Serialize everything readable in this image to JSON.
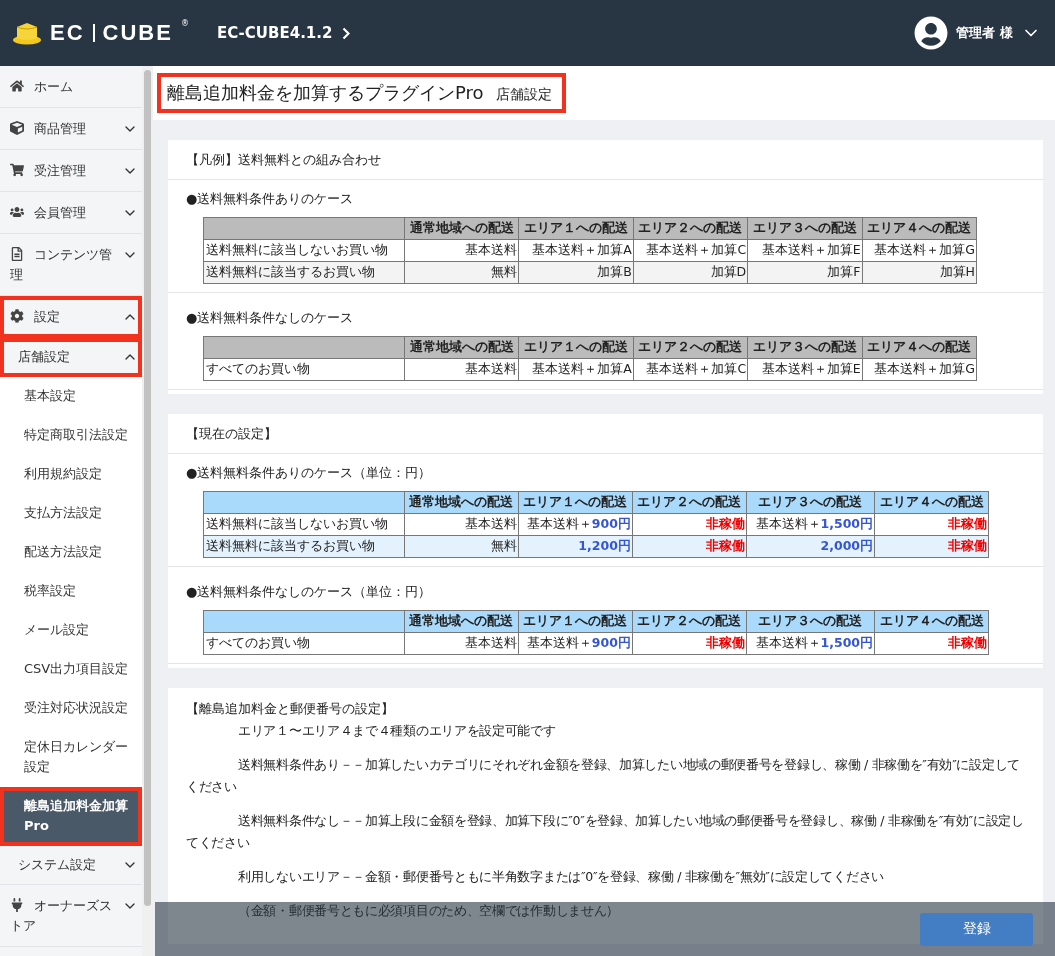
{
  "header": {
    "logo_words": [
      "EC",
      "CUBE"
    ],
    "logo_mark": "®",
    "shop": "EC-CUBE4.1.2",
    "user": "管理者 様"
  },
  "sidebar": {
    "items": [
      {
        "label": "ホーム",
        "selected": false,
        "highlighted": false
      },
      {
        "label": "商品管理",
        "expanded": false,
        "selected": false,
        "highlighted": false
      },
      {
        "label": "受注管理",
        "expanded": false,
        "selected": false,
        "highlighted": false
      },
      {
        "label": "会員管理",
        "expanded": false,
        "selected": false,
        "highlighted": false
      },
      {
        "label": "コンテンツ管理",
        "expanded": false,
        "selected": false,
        "highlighted": false
      },
      {
        "label": "設定",
        "expanded": true,
        "selected": false,
        "highlighted": true,
        "children": [
          {
            "label": "店舗設定",
            "expanded": true,
            "selected": false,
            "highlighted": true,
            "children": [
              {
                "label": "基本設定",
                "selected": false,
                "highlighted": false
              },
              {
                "label": "特定商取引法設定",
                "selected": false,
                "highlighted": false
              },
              {
                "label": "利用規約設定",
                "selected": false,
                "highlighted": false
              },
              {
                "label": "支払方法設定",
                "selected": false,
                "highlighted": false
              },
              {
                "label": "配送方法設定",
                "selected": false,
                "highlighted": false
              },
              {
                "label": "税率設定",
                "selected": false,
                "highlighted": false
              },
              {
                "label": "メール設定",
                "selected": false,
                "highlighted": false
              },
              {
                "label": "CSV出力項目設定",
                "selected": false,
                "highlighted": false
              },
              {
                "label": "受注対応状況設定",
                "selected": false,
                "highlighted": false
              },
              {
                "label": "定休日カレンダー設定",
                "selected": false,
                "highlighted": false
              },
              {
                "label": "離島追加料金加算Pro",
                "selected": true,
                "highlighted": true
              }
            ]
          },
          {
            "label": "システム設定",
            "expanded": false,
            "selected": false,
            "highlighted": false
          }
        ]
      },
      {
        "label": "オーナーズストア",
        "expanded": false,
        "selected": false,
        "highlighted": false
      }
    ]
  },
  "page": {
    "title": "離島追加料金を加算するプラグインPro",
    "subtitle": "店舗設定",
    "highlighted": true
  },
  "cards": [
    {
      "heading": "【凡例】送料無料との組み合わせ",
      "kind": "legend",
      "sections": [
        {
          "caption": "●送料無料条件ありのケース",
          "columns": [
            "通常地域への配送",
            "エリア１への配送",
            "エリア２への配送",
            "エリア３への配送",
            "エリア４への配送"
          ],
          "rows": [
            {
              "label": "送料無料に該当しないお買い物",
              "cells": [
                {
                  "text": "基本送料",
                  "kind": "plain"
                },
                {
                  "text": "基本送料＋加算A",
                  "kind": "plain"
                },
                {
                  "text": "基本送料＋加算C",
                  "kind": "plain"
                },
                {
                  "text": "基本送料＋加算E",
                  "kind": "plain"
                },
                {
                  "text": "基本送料＋加算G",
                  "kind": "plain"
                }
              ]
            },
            {
              "label": "送料無料に該当するお買い物",
              "cells": [
                {
                  "text": "無料",
                  "kind": "plain"
                },
                {
                  "text": "加算B",
                  "kind": "plain"
                },
                {
                  "text": "加算D",
                  "kind": "plain"
                },
                {
                  "text": "加算F",
                  "kind": "plain"
                },
                {
                  "text": "加算H",
                  "kind": "plain"
                }
              ]
            }
          ]
        },
        {
          "caption": "●送料無料条件なしのケース",
          "columns": [
            "通常地域への配送",
            "エリア１への配送",
            "エリア２への配送",
            "エリア３への配送",
            "エリア４への配送"
          ],
          "rows": [
            {
              "label": "すべてのお買い物",
              "cells": [
                {
                  "text": "基本送料",
                  "kind": "plain"
                },
                {
                  "text": "基本送料＋加算A",
                  "kind": "plain"
                },
                {
                  "text": "基本送料＋加算C",
                  "kind": "plain"
                },
                {
                  "text": "基本送料＋加算E",
                  "kind": "plain"
                },
                {
                  "text": "基本送料＋加算G",
                  "kind": "plain"
                }
              ]
            }
          ]
        }
      ]
    },
    {
      "heading": "【現在の設定】",
      "kind": "current",
      "sections": [
        {
          "caption": "●送料無料条件ありのケース（単位：円）",
          "columns": [
            "通常地域への配送",
            "エリア１への配送",
            "エリア２への配送",
            "エリア３への配送",
            "エリア４への配送"
          ],
          "rows": [
            {
              "label": "送料無料に該当しないお買い物",
              "cells": [
                {
                  "text": "基本送料",
                  "kind": "plain"
                },
                {
                  "text": "基本送料＋**900円**",
                  "kind": "plain"
                },
                {
                  "text": "非稼働",
                  "kind": "inactive"
                },
                {
                  "text": "基本送料＋**1,500円**",
                  "kind": "plain"
                },
                {
                  "text": "非稼働",
                  "kind": "inactive"
                }
              ]
            },
            {
              "label": "送料無料に該当するお買い物",
              "cells": [
                {
                  "text": "無料",
                  "kind": "plain"
                },
                {
                  "text": "1,200円",
                  "kind": "amount"
                },
                {
                  "text": "非稼働",
                  "kind": "inactive"
                },
                {
                  "text": "2,000円",
                  "kind": "amount"
                },
                {
                  "text": "非稼働",
                  "kind": "inactive"
                }
              ]
            }
          ]
        },
        {
          "caption": "●送料無料条件なしのケース（単位：円）",
          "columns": [
            "通常地域への配送",
            "エリア１への配送",
            "エリア２への配送",
            "エリア３への配送",
            "エリア４への配送"
          ],
          "rows": [
            {
              "label": "すべてのお買い物",
              "cells": [
                {
                  "text": "基本送料",
                  "kind": "plain"
                },
                {
                  "text": "基本送料＋**900円**",
                  "kind": "plain"
                },
                {
                  "text": "非稼働",
                  "kind": "inactive"
                },
                {
                  "text": "基本送料＋**1,500円**",
                  "kind": "plain"
                },
                {
                  "text": "非稼働",
                  "kind": "inactive"
                }
              ]
            }
          ]
        }
      ]
    }
  ],
  "notes": {
    "heading": "【離島追加料金と郵便番号の設定】",
    "paragraphs": [
      "エリア１〜エリア４まで４種類のエリアを設定可能です",
      "送料無料条件あり－－加算したいカテゴリにそれぞれ金額を登録、加算したい地域の郵便番号を登録し、稼働 / 非稼働を″有効″に設定してください",
      "送料無料条件なし－－加算上段に金額を登録、加算下段に″0″を登録、加算したい地域の郵便番号を登録し、稼働 / 非稼働を″有効″に設定してください",
      "利用しないエリア－－金額・郵便番号ともに半角数字または″0″を登録、稼働 / 非稼働を″無効″に設定してください",
      "（金額・郵便番号ともに必須項目のため、空欄では作動しません）"
    ]
  },
  "footer": {
    "submit": "登録"
  }
}
